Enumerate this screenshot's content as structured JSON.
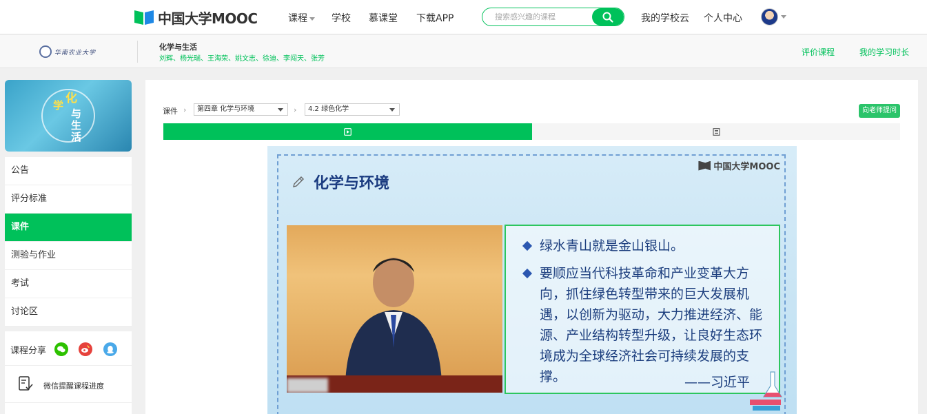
{
  "topbar": {
    "logo_text": "中国大学MOOC",
    "nav": [
      {
        "label": "课程",
        "has_caret": true
      },
      {
        "label": "学校"
      },
      {
        "label": "慕课堂"
      },
      {
        "label": "下载APP"
      }
    ],
    "search_placeholder": "搜索感兴趣的课程",
    "links": [
      "我的学校云",
      "个人中心"
    ]
  },
  "coursebar": {
    "school_name": "华南农业大学",
    "course_title": "化学与生活",
    "teachers": "刘辉、杨光瑞、王海荣、姚文志、徐迪、李闯天、张芳",
    "links": [
      "评价课程",
      "我的学习时长"
    ]
  },
  "sidebar": {
    "banner_chars": [
      "学",
      "化",
      "与",
      "生",
      "活"
    ],
    "menu": [
      {
        "label": "公告",
        "active": false
      },
      {
        "label": "评分标准",
        "active": false
      },
      {
        "label": "课件",
        "active": true
      },
      {
        "label": "测验与作业",
        "active": false
      },
      {
        "label": "考试",
        "active": false
      },
      {
        "label": "讨论区",
        "active": false
      }
    ],
    "share_label": "课程分享",
    "remind_label": "微信提醒课程进度"
  },
  "main": {
    "crumb_label": "课件",
    "chapter_select": "第四章 化学与环境",
    "lesson_select": "4.2 绿色化学",
    "ask_button": "向老师提问",
    "slide": {
      "logo": "中国大学MOOC",
      "title": "化学与环境",
      "bullet1": "绿水青山就是金山银山。",
      "bullet2": "要顺应当代科技革命和产业变革大方向，抓住绿色转型带来的巨大发展机遇，以创新为驱动，大力推进经济、能源、产业结构转型升级，让良好生态环境成为全球经济社会可持续发展的支撑。",
      "author": "——习近平"
    }
  },
  "colors": {
    "accent": "#00c15a",
    "slide_text": "#1c3e7e"
  }
}
